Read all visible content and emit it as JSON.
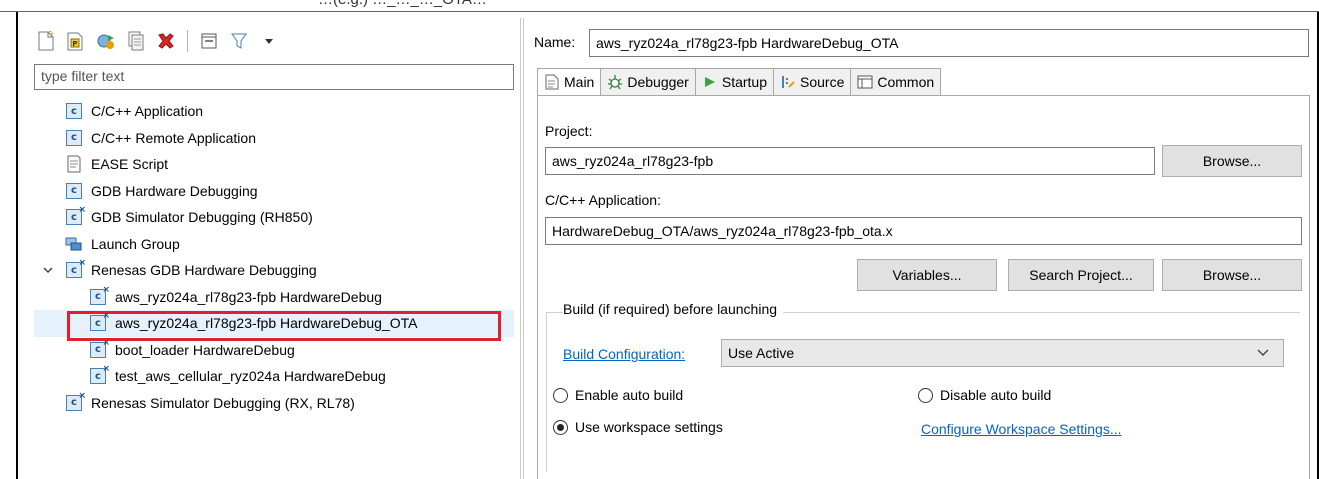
{
  "top_strip": {
    "text": "…(e.g.) …_…_…_OTA…"
  },
  "filter": {
    "placeholder": "type filter text"
  },
  "tree": {
    "items": [
      {
        "label": "C/C++ Application"
      },
      {
        "label": "C/C++ Remote Application"
      },
      {
        "label": "EASE Script"
      },
      {
        "label": "GDB Hardware Debugging"
      },
      {
        "label": "GDB Simulator Debugging (RH850)"
      },
      {
        "label": "Launch Group"
      },
      {
        "label": "Renesas GDB Hardware Debugging"
      },
      {
        "label": "aws_ryz024a_rl78g23-fpb HardwareDebug"
      },
      {
        "label": "aws_ryz024a_rl78g23-fpb HardwareDebug_OTA"
      },
      {
        "label": "boot_loader HardwareDebug"
      },
      {
        "label": "test_aws_cellular_ryz024a HardwareDebug"
      },
      {
        "label": "Renesas Simulator Debugging (RX, RL78)"
      }
    ]
  },
  "config": {
    "name_label": "Name:",
    "name_value": "aws_ryz024a_rl78g23-fpb HardwareDebug_OTA"
  },
  "tabs": [
    {
      "label": "Main",
      "icon": "main-tab-icon"
    },
    {
      "label": "Debugger",
      "icon": "debugger-icon"
    },
    {
      "label": "Startup",
      "icon": "startup-icon"
    },
    {
      "label": "Source",
      "icon": "source-icon"
    },
    {
      "label": "Common",
      "icon": "common-icon"
    }
  ],
  "main": {
    "project_label": "Project:",
    "project_value": "aws_ryz024a_rl78g23-fpb",
    "browse_label": "Browse...",
    "app_label": "C/C++ Application:",
    "app_value": "HardwareDebug_OTA/aws_ryz024a_rl78g23-fpb_ota.x",
    "variables_label": "Variables...",
    "search_project_label": "Search Project...",
    "browse2_label": "Browse...",
    "build_group_title": "Build (if required) before launching",
    "build_config_link": "Build Configuration:",
    "build_config_value": "Use Active",
    "enable_auto_build": "Enable auto build",
    "disable_auto_build": "Disable auto build",
    "use_workspace": "Use workspace settings",
    "configure_workspace": "Configure Workspace Settings..."
  },
  "colors": {
    "selection_highlight": "#e0202e",
    "link": "#0563c1",
    "selected_row": "#e5f1fb"
  }
}
